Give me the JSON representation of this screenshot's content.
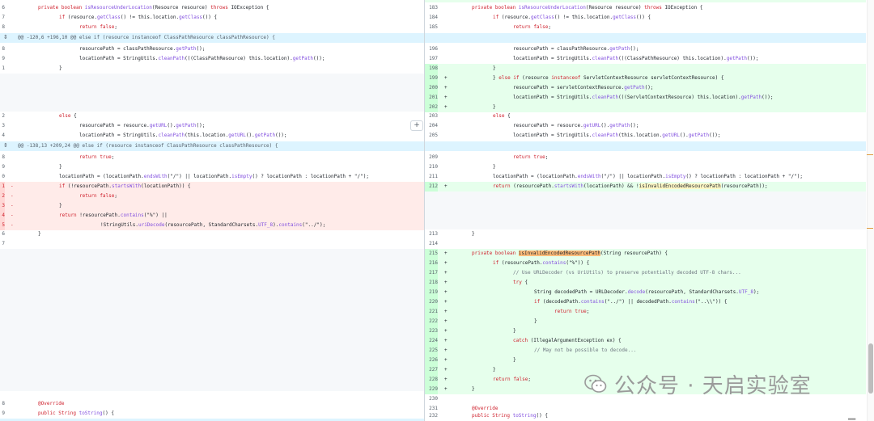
{
  "hunks": [
    "@@ -120,6 +196,10 @@ else if (resource instanceof ClassPathResource classPathResource) {",
    "@@ -138,13 +209,24 @@ else if (resource instanceof ClassPathResource classPathResource) {"
  ],
  "left_lines": [
    {
      "num": "6",
      "type": "ctx"
    },
    {
      "num": "7",
      "type": "ctx"
    },
    {
      "num": "8",
      "type": "ctx"
    },
    {
      "num": "8",
      "type": "ctx"
    },
    {
      "num": "9",
      "type": "ctx"
    },
    {
      "num": "1",
      "type": "ctx"
    },
    {
      "num": "2",
      "type": "ctx"
    },
    {
      "num": "3",
      "type": "ctx"
    },
    {
      "num": "4",
      "type": "ctx"
    },
    {
      "num": "8",
      "type": "ctx"
    },
    {
      "num": "9",
      "type": "ctx"
    },
    {
      "num": "0",
      "type": "ctx"
    },
    {
      "num": "1",
      "type": "del",
      "sign": "-"
    },
    {
      "num": "2",
      "type": "del",
      "sign": "-"
    },
    {
      "num": "3",
      "type": "del",
      "sign": "-"
    },
    {
      "num": "4",
      "type": "del",
      "sign": "-"
    },
    {
      "num": "5",
      "type": "del",
      "sign": "-"
    },
    {
      "num": "6",
      "type": "ctx"
    },
    {
      "num": "7",
      "type": "ctx"
    },
    {
      "num": "8",
      "type": "ctx"
    },
    {
      "num": "9",
      "type": "ctx"
    }
  ],
  "right_nums": {
    "l183": "183",
    "l184": "184",
    "l185": "185",
    "l196": "196",
    "l197": "197",
    "l198": "198",
    "l199": "199",
    "l200": "200",
    "l201": "201",
    "l202": "202",
    "l203": "203",
    "l204": "204",
    "l205": "205",
    "l209": "209",
    "l210": "210",
    "l211": "211",
    "l212": "212",
    "l213": "213",
    "l214": "214",
    "l215": "215",
    "l216": "216",
    "l217": "217",
    "l218": "218",
    "l219": "219",
    "l220": "220",
    "l221": "221",
    "l222": "222",
    "l223": "223",
    "l224": "224",
    "l225": "225",
    "l226": "226",
    "l227": "227",
    "l228": "228",
    "l229": "229",
    "l230": "230",
    "l231": "231",
    "l232": "232"
  },
  "signs": {
    "plus": "+",
    "minus": "-"
  },
  "code": {
    "method_sig_a": "private boolean ",
    "method_sig_name": "isResourceUnderLocation",
    "method_sig_b": "(Resource resource) ",
    "method_sig_throws": "throws",
    "method_sig_c": " IOException {",
    "if_class_a": "if",
    "if_class_b": " (resource.",
    "if_class_fn1": "getClass",
    "if_class_c": "() != this.location.",
    "if_class_fn2": "getClass",
    "if_class_d": "()) {",
    "return_kw": "return",
    "false_kw": "false",
    "true_kw": "true",
    "semicolon": ";",
    "res_path_a": "resourcePath = classPathResource.",
    "res_path_fn": "getPath",
    "res_path_b": "();",
    "loc_path_a": "locationPath = StringUtils.",
    "clean_fn": "cleanPath",
    "loc_path_b": "(((ClassPathResource) this.location).",
    "get_path_fn": "getPath",
    "loc_path_c": "());",
    "close_brace": "}",
    "else_if_kw": "else if",
    "else_if_b": " (resource ",
    "instanceof_kw": "instanceof",
    "else_if_c": " ServletContextResource servletContextResource) {",
    "sc_res_a": "resourcePath = servletContextResource.",
    "sc_res_b": "();",
    "sc_loc_b": "(((ServletContextResource) this.location).",
    "else_kw": "else",
    "else_b": " {",
    "url_res_a": "resourcePath = resource.",
    "get_url_fn": "getURL",
    "url_res_b": "().",
    "url_res_c": "();",
    "url_loc_a": "locationPath = StringUtils.",
    "url_loc_b": "(this.location.",
    "url_loc_c": "().",
    "url_loc_d": "());",
    "return_true_line": "return true;",
    "loc_ends_a": "locationPath = (locationPath.",
    "ends_fn": "endsWith",
    "loc_ends_b": "(\"/\") || locationPath.",
    "is_empty_fn": "isEmpty",
    "loc_ends_c": "() ? locationPath : locationPath + \"/\");",
    "old_if_a": "if",
    "old_if_b": " (!resourcePath.",
    "starts_fn": "startsWith",
    "old_if_c": "(locationPath)) {",
    "old_return_a": "return",
    "old_return_b": " !resourcePath.",
    "contains_fn": "contains",
    "old_return_c": "(\"%\") ||",
    "old_uri_a": "!StringUtils.",
    "uri_decode_fn": "uriDecode",
    "old_uri_b": "(resourcePath, StandardCharsets.",
    "utf8": "UTF_8",
    "old_uri_c": ").",
    "old_uri_d": "(\"../\");",
    "new_return_a": " (resourcePath.",
    "new_return_b": "(locationPath) && !",
    "invalid_fn": "isInvalidEncodedResourcePath",
    "new_return_c": "(resourcePath));",
    "new_method_a": "private boolean ",
    "new_method_b": "(String resourcePath) {",
    "new_if_b": " (resourcePath.",
    "new_if_c": "(\"%\")) {",
    "comment1": "// Use URLDecoder (vs UriUtils) to preserve potentially decoded UTF-8 chars...",
    "try_kw": "try",
    "try_b": " {",
    "decoded_a": "String decodedPath = URLDecoder.",
    "decode_fn": "decode",
    "decoded_b": "(resourcePath, StandardCharsets.",
    "decoded_c": ");",
    "if_dec_b": " (decodedPath.",
    "if_dec_c": "(\"../\") || decodedPath.",
    "if_dec_d": "(\"..\\\\\")) {",
    "catch_kw": "catch",
    "catch_b": " (IllegalArgumentException ex) {",
    "comment2": "// May not be possible to decode...",
    "return_false_line": "return false;",
    "override": "@Override",
    "to_string_a": "public String ",
    "to_string_fn": "toString",
    "to_string_b": "() {"
  },
  "expand_button_label": "+",
  "watermark_text": "公众号 · 天启实验室",
  "icons": {
    "expand": "expand-icon",
    "wechat": "wechat-icon",
    "add_comment": "plus-icon"
  },
  "colors": {
    "add_bg": "#e6ffec",
    "del_bg": "#ffebe9",
    "hunk_bg": "#ddf4ff",
    "empty_bg": "#f6f8fa"
  }
}
